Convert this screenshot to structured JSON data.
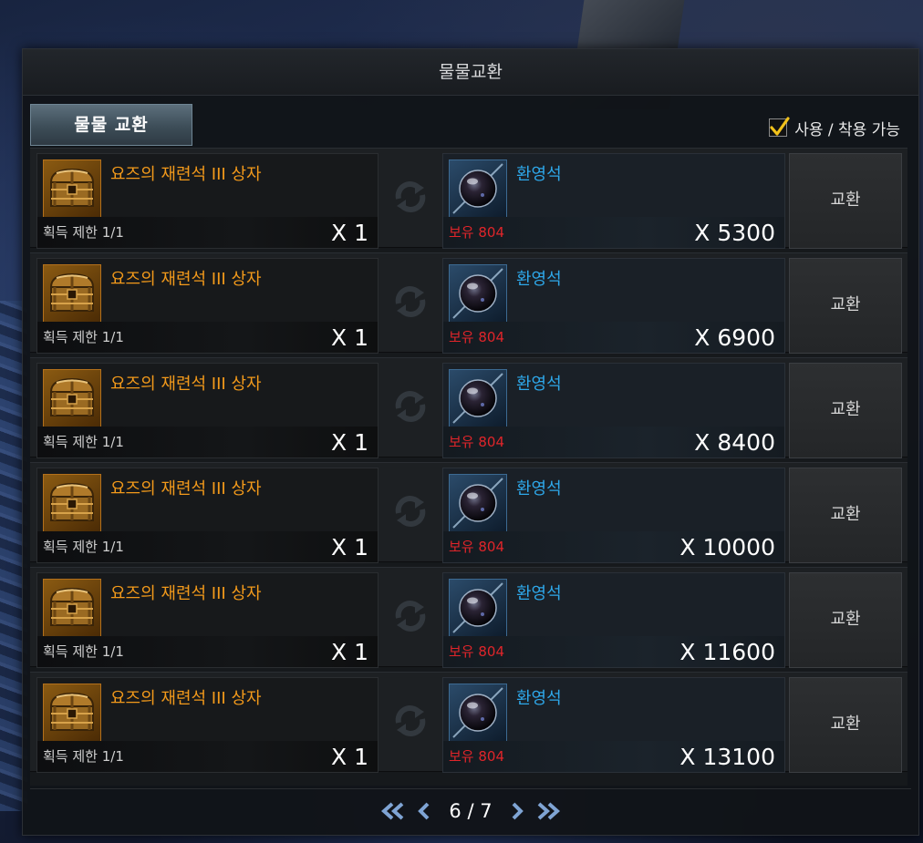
{
  "window": {
    "title": "물물교환"
  },
  "tab": {
    "label": "물물 교환"
  },
  "filter": {
    "label": "사용 / 착용 가능",
    "checked": true
  },
  "rows": [
    {
      "give_name": "요즈의 재련석 III 상자",
      "give_limit": "획득 제한 1/1",
      "give_qty": "X 1",
      "get_name": "환영석",
      "get_owned": "보유 804",
      "get_qty": "X 5300",
      "button": "교환"
    },
    {
      "give_name": "요즈의 재련석 III 상자",
      "give_limit": "획득 제한 1/1",
      "give_qty": "X 1",
      "get_name": "환영석",
      "get_owned": "보유 804",
      "get_qty": "X 6900",
      "button": "교환"
    },
    {
      "give_name": "요즈의 재련석 III 상자",
      "give_limit": "획득 제한 1/1",
      "give_qty": "X 1",
      "get_name": "환영석",
      "get_owned": "보유 804",
      "get_qty": "X 8400",
      "button": "교환"
    },
    {
      "give_name": "요즈의 재련석 III 상자",
      "give_limit": "획득 제한 1/1",
      "give_qty": "X 1",
      "get_name": "환영석",
      "get_owned": "보유 804",
      "get_qty": "X 10000",
      "button": "교환"
    },
    {
      "give_name": "요즈의 재련석 III 상자",
      "give_limit": "획득 제한 1/1",
      "give_qty": "X 1",
      "get_name": "환영석",
      "get_owned": "보유 804",
      "get_qty": "X 11600",
      "button": "교환"
    },
    {
      "give_name": "요즈의 재련석 III 상자",
      "give_limit": "획득 제한 1/1",
      "give_qty": "X 1",
      "get_name": "환영석",
      "get_owned": "보유 804",
      "get_qty": "X 13100",
      "button": "교환"
    }
  ],
  "pager": {
    "current": 6,
    "total": 7,
    "text": "6 / 7"
  },
  "icons": {
    "give_item": "treasure-chest-icon",
    "get_item": "phantom-stone-orb-icon",
    "swap": "swap-arrows-icon",
    "first": "double-chevron-left-icon",
    "prev": "chevron-left-icon",
    "next": "chevron-right-icon",
    "last": "double-chevron-right-icon"
  },
  "colors": {
    "give_name": "#f39a1b",
    "get_name": "#2ea8ea",
    "owned": "#e0252a",
    "check": "#f2c21b"
  }
}
